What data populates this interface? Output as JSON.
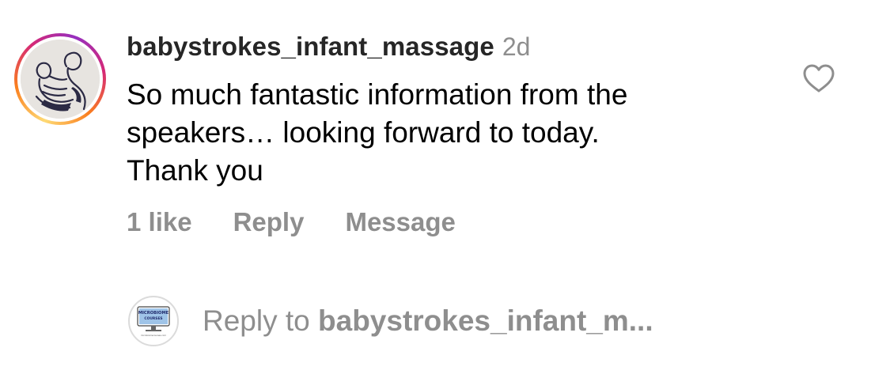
{
  "comment": {
    "username": "babystrokes_infant_massage",
    "time_ago": "2d",
    "text": "So much fantastic information from the speakers… looking forward to today. Thank you",
    "text_lines": [
      "So much fantastic information from the",
      "speakers… looking forward to today.",
      "Thank you"
    ],
    "like_icon": "heart-outline-icon"
  },
  "actions": {
    "likes": "1 like",
    "reply": "Reply",
    "message": "Message"
  },
  "reply_input": {
    "prefix": "Reply to",
    "target": "babystrokes_infant_m..."
  },
  "reply_avatar_logo": {
    "line1": "MICROBIOME",
    "line2": "COURSES",
    "footer": "microbiomecourses.com"
  },
  "colors": {
    "username": "#262626",
    "secondary": "#8e8e8e",
    "ring_start": "#feda75",
    "ring_mid": "#d62976",
    "ring_end": "#962fbf"
  }
}
